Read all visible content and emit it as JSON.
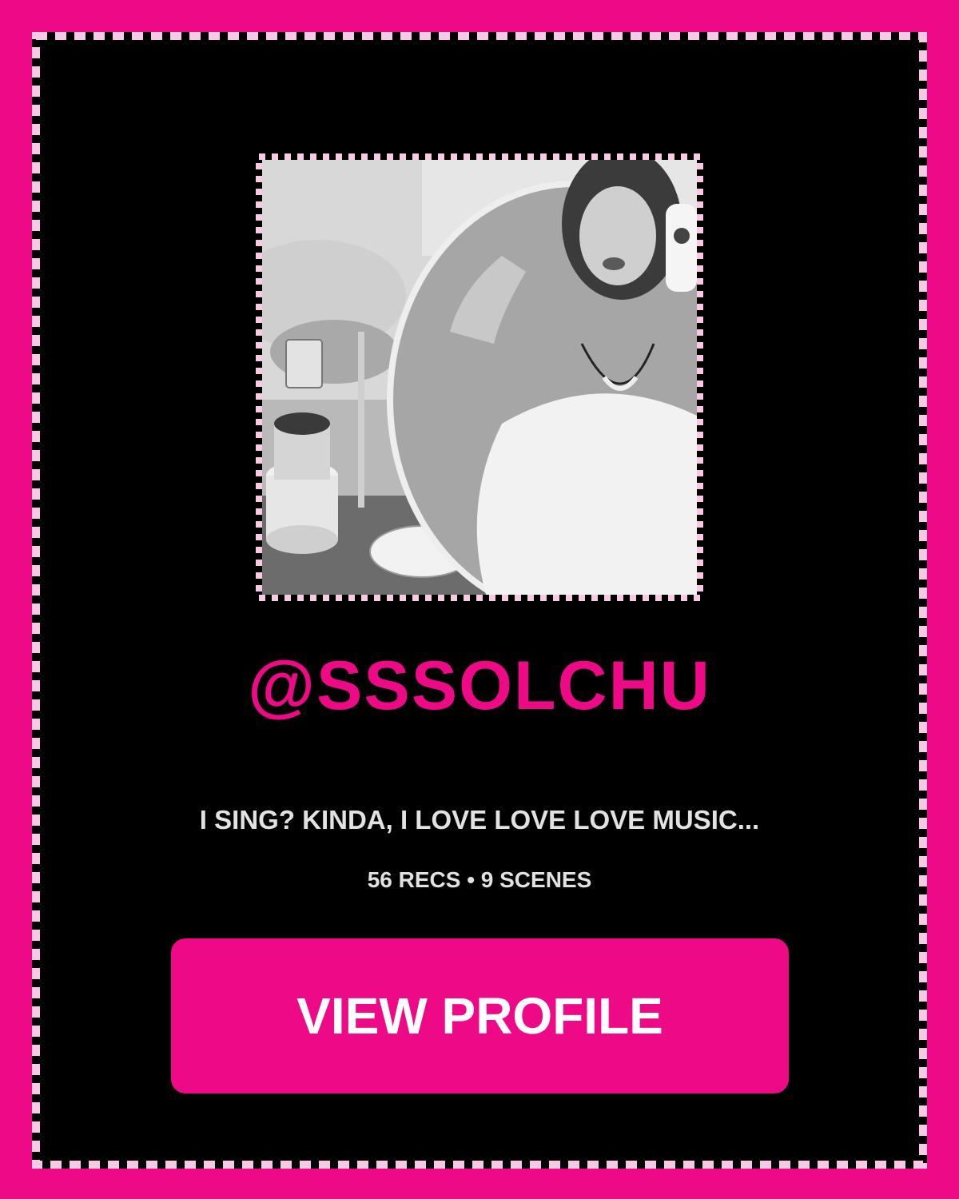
{
  "profile": {
    "handle": "@SSSOLCHU",
    "bio": "I SING? KINDA, I LOVE LOVE LOVE MUSIC...",
    "stats": "56 RECS • 9 SCENES",
    "photo_alt": "Profile photo"
  },
  "actions": {
    "view_profile_label": "VIEW PROFILE"
  },
  "colors": {
    "accent": "#ee0a86",
    "card_background": "#000000",
    "dash_light": "#f7c9e4",
    "text_muted": "#e2e2e2"
  }
}
